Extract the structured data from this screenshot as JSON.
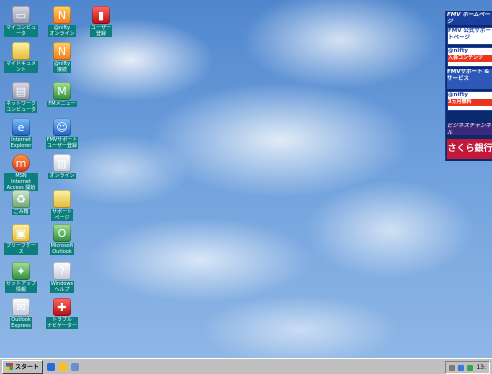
{
  "desktop_icons": [
    {
      "id": "my-computer",
      "label": "マイコンピュータ",
      "icon": "computer-icon"
    },
    {
      "id": "nifty-1",
      "label": "@nifty\nオンライン",
      "icon": "nifty-icon"
    },
    {
      "id": "user-1",
      "label": "ユーザー\n登録",
      "icon": "door-icon"
    },
    {
      "id": "my-documents",
      "label": "マイドキュメント",
      "icon": "folder-icon"
    },
    {
      "id": "nifty-2",
      "label": "@nifty\n接続",
      "icon": "nifty-icon"
    },
    {
      "id": "network",
      "label": "ネットワーク\nコンピュータ",
      "icon": "network-icon"
    },
    {
      "id": "fm-menu",
      "label": "FMメニュー",
      "icon": "fm-icon"
    },
    {
      "id": "ie",
      "label": "Internet\nExplorer",
      "icon": "ie-icon"
    },
    {
      "id": "fmv-support",
      "label": "FMVサポート\nユーザー登録",
      "icon": "people-icon"
    },
    {
      "id": "msn",
      "label": "MSN Internet\nAccess 開始",
      "icon": "msn-icon"
    },
    {
      "id": "online",
      "label": "オンライン",
      "icon": "book-icon"
    },
    {
      "id": "recycle",
      "label": "ごみ箱",
      "icon": "recycle-bin-icon"
    },
    {
      "id": "sapport",
      "label": "サポート\nページ",
      "icon": "folder-icon"
    },
    {
      "id": "briefcase",
      "label": "ブリーフケース",
      "icon": "briefcase-icon"
    },
    {
      "id": "outlook",
      "label": "Microsoft\nOutlook",
      "icon": "outlook-icon"
    },
    {
      "id": "setup",
      "label": "セットアップ\n情報",
      "icon": "setup-icon"
    },
    {
      "id": "help",
      "label": "Windows\nヘルプ",
      "icon": "help-icon"
    },
    {
      "id": "outlook-express",
      "label": "Outlook\nExpress",
      "icon": "mail-icon"
    },
    {
      "id": "reminder",
      "label": "トラブル\nナビゲーター",
      "icon": "ambulance-icon"
    }
  ],
  "ad_panel": {
    "fmv_header": "FMV ホームページ",
    "support": "FMV 公式サポートページ",
    "nifty1_title": "@nifty",
    "nifty1_strip": "入会コンテンツ",
    "service": "FMVサポート & サービス",
    "nifty2_title": "@nifty",
    "nifty2_strip": "3ヵ月無料",
    "biz": "ビジネスチャンネル",
    "sakura": "さくら銀行"
  },
  "taskbar": {
    "start_label": "スタート",
    "clock": "13:"
  },
  "colors": {
    "taskbar": "#c0c0c0",
    "label_bg": "#0c7e7e",
    "sakura": "#c4183a",
    "fmv_blue": "#1b3f9c"
  }
}
